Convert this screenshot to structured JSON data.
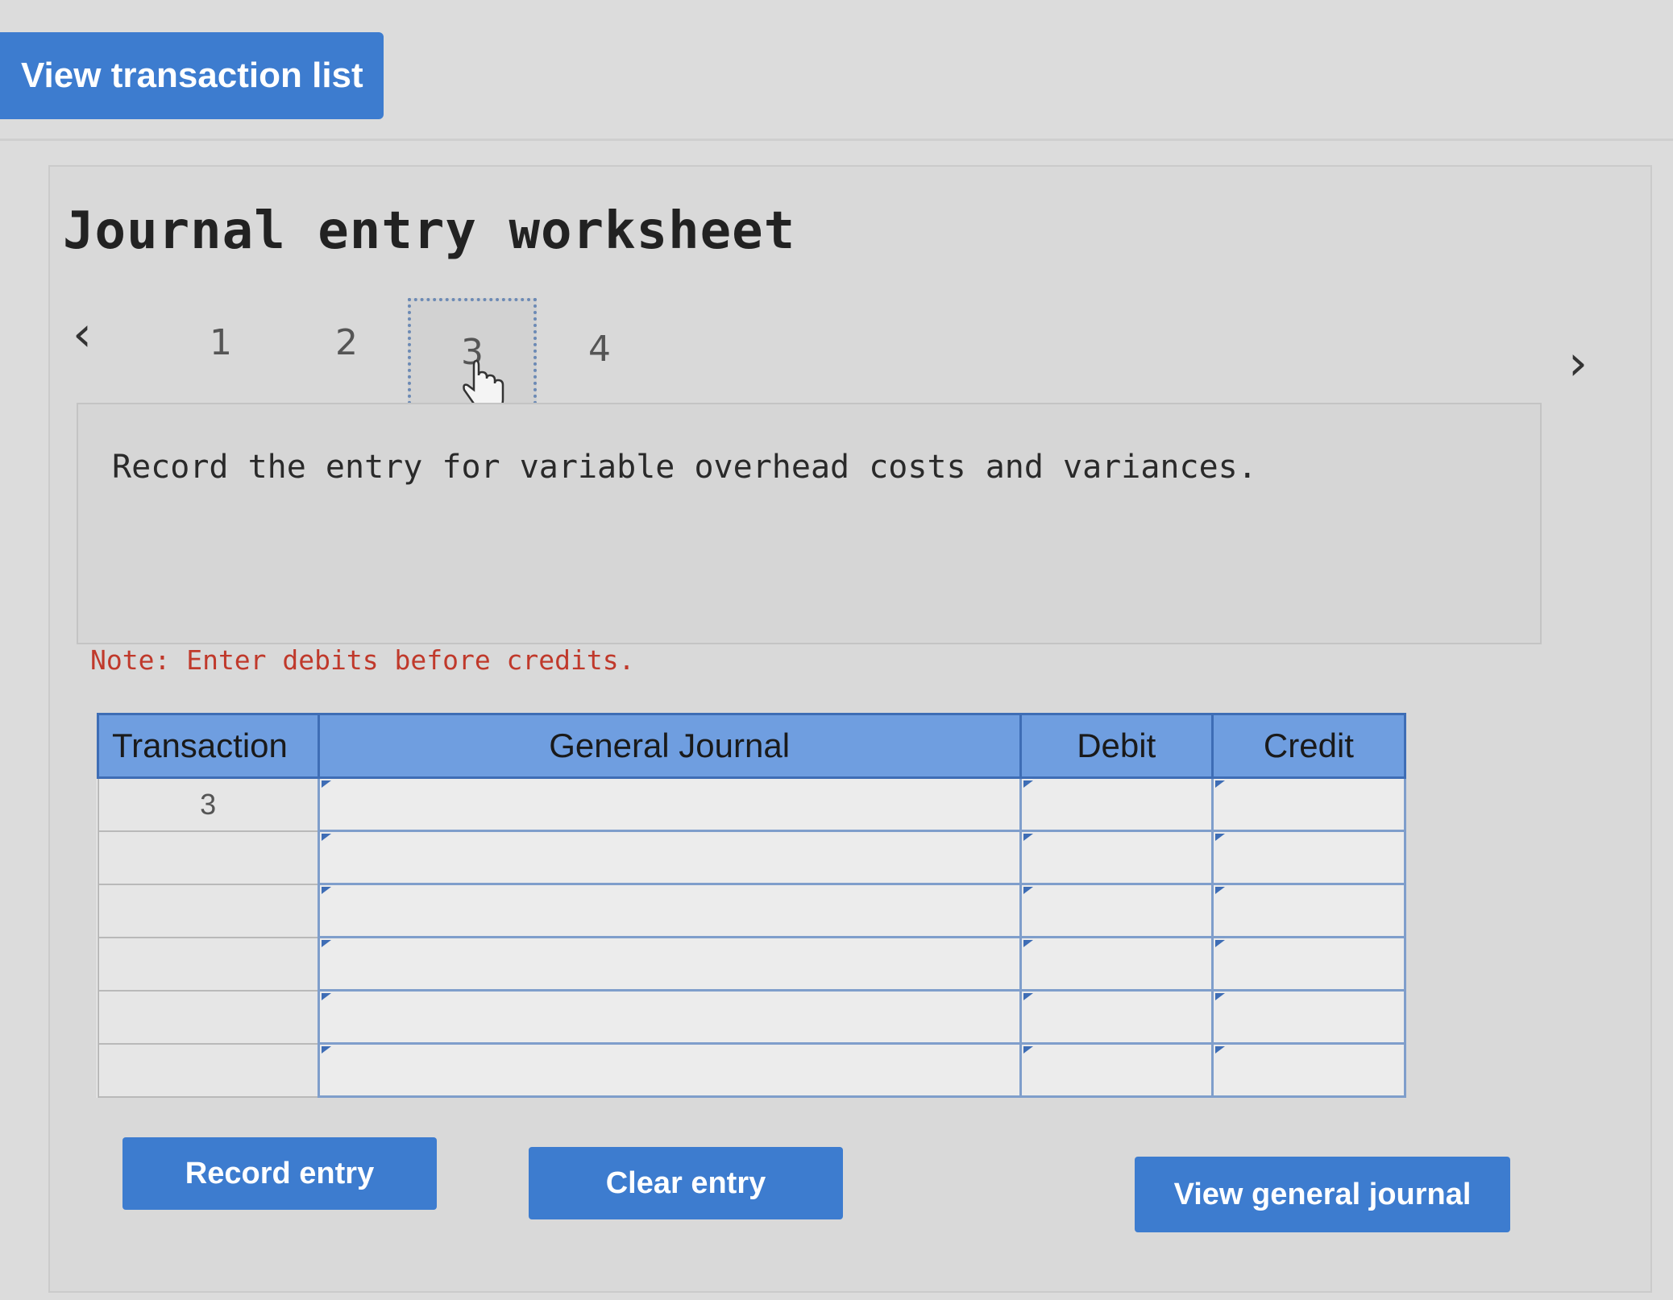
{
  "header": {
    "view_transaction_list_label": "View transaction list"
  },
  "worksheet": {
    "title": "Journal entry worksheet",
    "pager": {
      "prev_icon": "chevron-left-icon",
      "next_icon": "chevron-right-icon",
      "pages": [
        "1",
        "2",
        "3",
        "4"
      ],
      "active_page": "3"
    },
    "prompt": "Record the entry for variable overhead costs and variances.",
    "note": "Note: Enter debits before credits."
  },
  "table": {
    "headers": {
      "transaction": "Transaction",
      "general_journal": "General Journal",
      "debit": "Debit",
      "credit": "Credit"
    },
    "rows": [
      {
        "transaction": "3",
        "account": "",
        "debit": "",
        "credit": ""
      },
      {
        "transaction": "",
        "account": "",
        "debit": "",
        "credit": ""
      },
      {
        "transaction": "",
        "account": "",
        "debit": "",
        "credit": ""
      },
      {
        "transaction": "",
        "account": "",
        "debit": "",
        "credit": ""
      },
      {
        "transaction": "",
        "account": "",
        "debit": "",
        "credit": ""
      },
      {
        "transaction": "",
        "account": "",
        "debit": "",
        "credit": ""
      }
    ]
  },
  "actions": {
    "record_entry_label": "Record entry",
    "clear_entry_label": "Clear entry",
    "view_general_journal_label": "View general journal"
  },
  "colors": {
    "accent_blue": "#3d7ccf",
    "header_blue": "#6f9ee0",
    "note_red": "#c0392b"
  }
}
